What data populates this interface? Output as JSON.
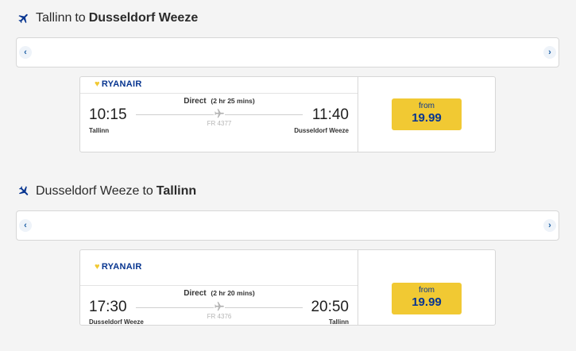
{
  "outbound": {
    "origin": "Tallinn",
    "connector": "to",
    "destination": "Dusseldorf Weeze",
    "carousel": {
      "prev": "‹",
      "next": "›"
    },
    "flight": {
      "airline": "RYANAIR",
      "dep_time": "10:15",
      "arr_time": "11:40",
      "dep_city": "Tallinn",
      "arr_city": "Dusseldorf Weeze",
      "stops": "Direct",
      "duration": "(2 hr 25 mins)",
      "flight_number": "FR 4377",
      "price_label": "from",
      "price": "19.99"
    }
  },
  "inbound": {
    "origin": "Dusseldorf Weeze",
    "connector": "to",
    "destination": "Tallinn",
    "carousel": {
      "prev": "‹",
      "next": "›"
    },
    "flight": {
      "airline": "RYANAIR",
      "dep_time": "17:30",
      "arr_time": "20:50",
      "dep_city": "Dusseldorf Weeze",
      "arr_city": "Tallinn",
      "stops": "Direct",
      "duration": "(2 hr 20 mins)",
      "flight_number": "FR 4376",
      "price_label": "from",
      "price": "19.99"
    }
  },
  "colors": {
    "ryanair_blue": "#073590",
    "ryanair_yellow": "#f1c933",
    "nav_blue": "#1d5fa5"
  },
  "icons": {
    "section_icon": "airplane-icon",
    "route_icon": "airplane-icon",
    "logo_icon": "harp-icon"
  }
}
